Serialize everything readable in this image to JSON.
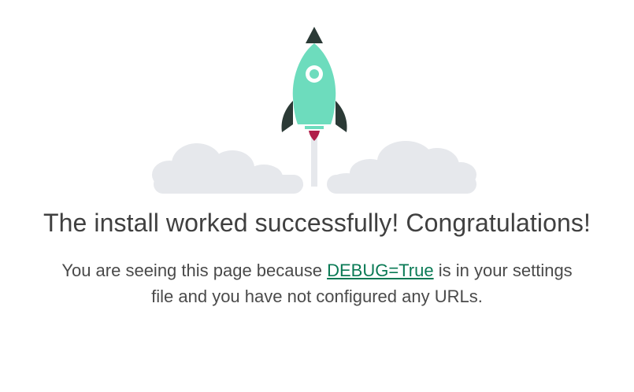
{
  "headline": "The install worked successfully! Congratulations!",
  "message": {
    "prefix": "You are seeing this page because ",
    "link_text": "DEBUG=True",
    "suffix": " is in your settings file and you have not configured any URLs."
  },
  "illustration": {
    "icon": "rocket-icon",
    "clouds": "cloud-icon",
    "colors": {
      "rocket_body": "#6ddcbd",
      "rocket_dark": "#2b3a36",
      "flame": "#b01e4a",
      "cloud": "#e6e8ec",
      "exhaust": "#e6e8ec"
    }
  },
  "colors": {
    "text": "#404040",
    "link": "#0a7a55",
    "background": "#ffffff"
  }
}
